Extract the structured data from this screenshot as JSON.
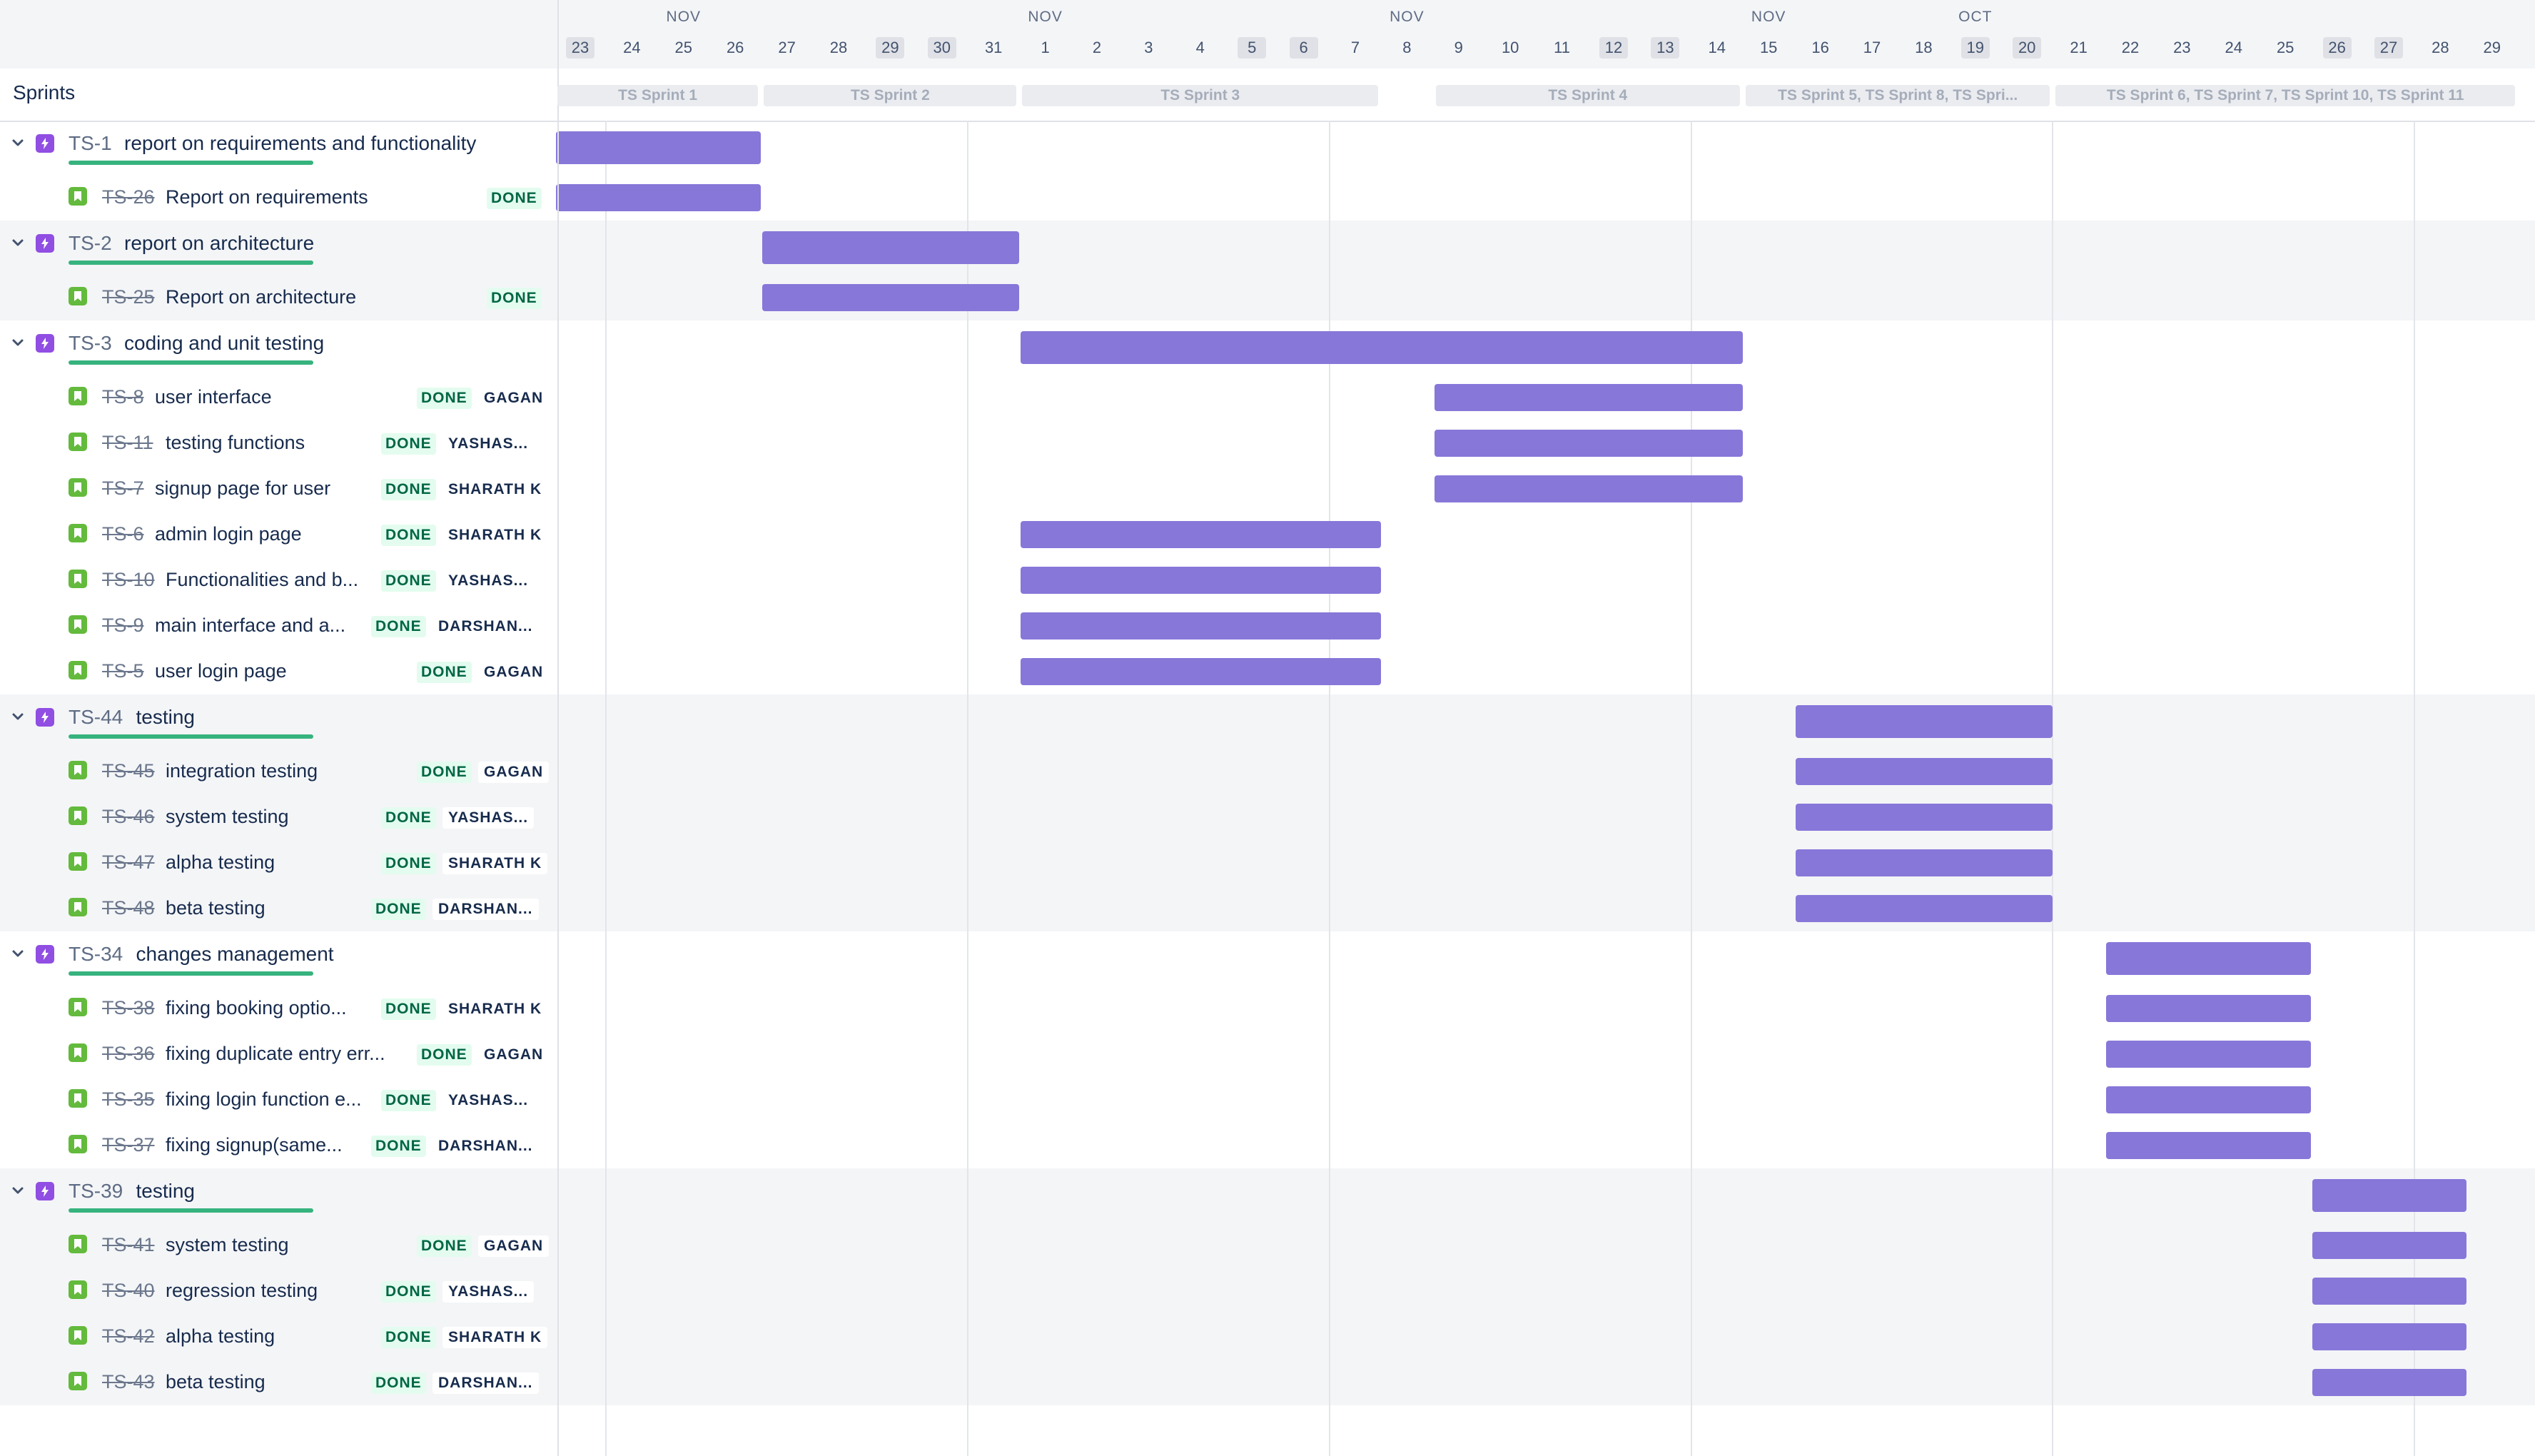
{
  "timeline": {
    "months": [
      {
        "label": "OCT",
        "day": 27
      },
      {
        "label": "NOV",
        "day": 2
      },
      {
        "label": "NOV",
        "day": 9
      },
      {
        "label": "NOV",
        "day": 16
      },
      {
        "label": "NOV",
        "day": 23
      }
    ],
    "days": [
      {
        "label": "23",
        "weekend": true
      },
      {
        "label": "24",
        "weekend": false
      },
      {
        "label": "25",
        "weekend": false
      },
      {
        "label": "26",
        "weekend": false
      },
      {
        "label": "27",
        "weekend": false
      },
      {
        "label": "28",
        "weekend": false
      },
      {
        "label": "29",
        "weekend": true
      },
      {
        "label": "30",
        "weekend": true
      },
      {
        "label": "31",
        "weekend": false
      },
      {
        "label": "1",
        "weekend": false
      },
      {
        "label": "2",
        "weekend": false
      },
      {
        "label": "3",
        "weekend": false
      },
      {
        "label": "4",
        "weekend": false
      },
      {
        "label": "5",
        "weekend": true
      },
      {
        "label": "6",
        "weekend": true
      },
      {
        "label": "7",
        "weekend": false
      },
      {
        "label": "8",
        "weekend": false
      },
      {
        "label": "9",
        "weekend": false
      },
      {
        "label": "10",
        "weekend": false
      },
      {
        "label": "11",
        "weekend": false
      },
      {
        "label": "12",
        "weekend": true
      },
      {
        "label": "13",
        "weekend": true
      },
      {
        "label": "14",
        "weekend": false
      },
      {
        "label": "15",
        "weekend": false
      },
      {
        "label": "16",
        "weekend": false
      },
      {
        "label": "17",
        "weekend": false
      },
      {
        "label": "18",
        "weekend": false
      },
      {
        "label": "19",
        "weekend": true
      },
      {
        "label": "20",
        "weekend": true
      },
      {
        "label": "21",
        "weekend": false
      },
      {
        "label": "22",
        "weekend": false
      },
      {
        "label": "23",
        "weekend": false
      },
      {
        "label": "24",
        "weekend": false
      },
      {
        "label": "25",
        "weekend": false
      },
      {
        "label": "26",
        "weekend": true
      },
      {
        "label": "27",
        "weekend": true
      },
      {
        "label": "28",
        "weekend": false
      },
      {
        "label": "29",
        "weekend": false
      }
    ]
  },
  "sprints_label": "Sprints",
  "sprints": [
    {
      "label": "TS Sprint 1",
      "start": 0,
      "end": 4
    },
    {
      "label": "TS Sprint 2",
      "start": 4,
      "end": 9
    },
    {
      "label": "TS Sprint 3",
      "start": 9,
      "end": 16
    },
    {
      "label": "TS Sprint 4",
      "start": 17,
      "end": 23
    },
    {
      "label": "TS Sprint 5, TS Sprint 8, TS Spri...",
      "start": 23,
      "end": 29
    },
    {
      "label": "TS Sprint 6, TS Sprint 7, TS Sprint 10, TS Sprint 11",
      "start": 29,
      "end": 38
    }
  ],
  "groups": [
    {
      "key": "TS-1",
      "title": "report on requirements and functionality",
      "start": 0,
      "end": 4,
      "stories": [
        {
          "key": "TS-26",
          "title": "Report on requirements",
          "status": "DONE",
          "assignee": "",
          "start": 0,
          "end": 4
        }
      ]
    },
    {
      "key": "TS-2",
      "title": "report on architecture",
      "start": 4,
      "end": 9,
      "stories": [
        {
          "key": "TS-25",
          "title": "Report on architecture",
          "status": "DONE",
          "assignee": "",
          "start": 4,
          "end": 9
        }
      ]
    },
    {
      "key": "TS-3",
      "title": "coding and unit testing",
      "start": 9,
      "end": 23,
      "stories": [
        {
          "key": "TS-8",
          "title": "user interface",
          "status": "DONE",
          "assignee": "GAGAN",
          "start": 17,
          "end": 23
        },
        {
          "key": "TS-11",
          "title": "testing functions",
          "status": "DONE",
          "assignee": "YASHAS...",
          "start": 17,
          "end": 23
        },
        {
          "key": "TS-7",
          "title": "signup page for user",
          "status": "DONE",
          "assignee": "SHARATH K",
          "start": 17,
          "end": 23
        },
        {
          "key": "TS-6",
          "title": "admin login page",
          "status": "DONE",
          "assignee": "SHARATH K",
          "start": 9,
          "end": 16
        },
        {
          "key": "TS-10",
          "title": "Functionalities and b...",
          "status": "DONE",
          "assignee": "YASHAS...",
          "start": 9,
          "end": 16
        },
        {
          "key": "TS-9",
          "title": "main interface and a...",
          "status": "DONE",
          "assignee": "DARSHAN...",
          "start": 9,
          "end": 16
        },
        {
          "key": "TS-5",
          "title": "user login page",
          "status": "DONE",
          "assignee": "GAGAN",
          "start": 9,
          "end": 16
        }
      ]
    },
    {
      "key": "TS-44",
      "title": "testing",
      "start": 24,
      "end": 29,
      "stories": [
        {
          "key": "TS-45",
          "title": "integration testing",
          "status": "DONE",
          "assignee": "GAGAN",
          "start": 24,
          "end": 29
        },
        {
          "key": "TS-46",
          "title": "system testing",
          "status": "DONE",
          "assignee": "YASHAS...",
          "start": 24,
          "end": 29
        },
        {
          "key": "TS-47",
          "title": "alpha testing",
          "status": "DONE",
          "assignee": "SHARATH K",
          "start": 24,
          "end": 29
        },
        {
          "key": "TS-48",
          "title": "beta testing",
          "status": "DONE",
          "assignee": "DARSHAN...",
          "start": 24,
          "end": 29
        }
      ]
    },
    {
      "key": "TS-34",
      "title": "changes management",
      "start": 30,
      "end": 34,
      "stories": [
        {
          "key": "TS-38",
          "title": "fixing booking optio...",
          "status": "DONE",
          "assignee": "SHARATH K",
          "start": 30,
          "end": 34
        },
        {
          "key": "TS-36",
          "title": "fixing duplicate entry err...",
          "status": "DONE",
          "assignee": "GAGAN",
          "start": 30,
          "end": 34
        },
        {
          "key": "TS-35",
          "title": "fixing login function e...",
          "status": "DONE",
          "assignee": "YASHAS...",
          "start": 30,
          "end": 34
        },
        {
          "key": "TS-37",
          "title": "fixing signup(same...",
          "status": "DONE",
          "assignee": "DARSHAN...",
          "start": 30,
          "end": 34
        }
      ]
    },
    {
      "key": "TS-39",
      "title": "testing",
      "start": 34,
      "end": 37,
      "stories": [
        {
          "key": "TS-41",
          "title": "system testing",
          "status": "DONE",
          "assignee": "GAGAN",
          "start": 34,
          "end": 37
        },
        {
          "key": "TS-40",
          "title": "regression testing",
          "status": "DONE",
          "assignee": "YASHAS...",
          "start": 34,
          "end": 37
        },
        {
          "key": "TS-42",
          "title": "alpha testing",
          "status": "DONE",
          "assignee": "SHARATH K",
          "start": 34,
          "end": 37
        },
        {
          "key": "TS-43",
          "title": "beta testing",
          "status": "DONE",
          "assignee": "DARSHAN...",
          "start": 34,
          "end": 37
        }
      ]
    }
  ],
  "colors": {
    "bar": "#8777d9",
    "epic_icon": "#904ee2",
    "story_icon": "#63ba3c",
    "progress": "#36b37e",
    "done_bg": "#e3fcef",
    "done_text": "#006644"
  },
  "icons": {
    "expand": "chevron-down-icon",
    "epic": "epic-lightning-icon",
    "story": "story-bookmark-icon"
  }
}
